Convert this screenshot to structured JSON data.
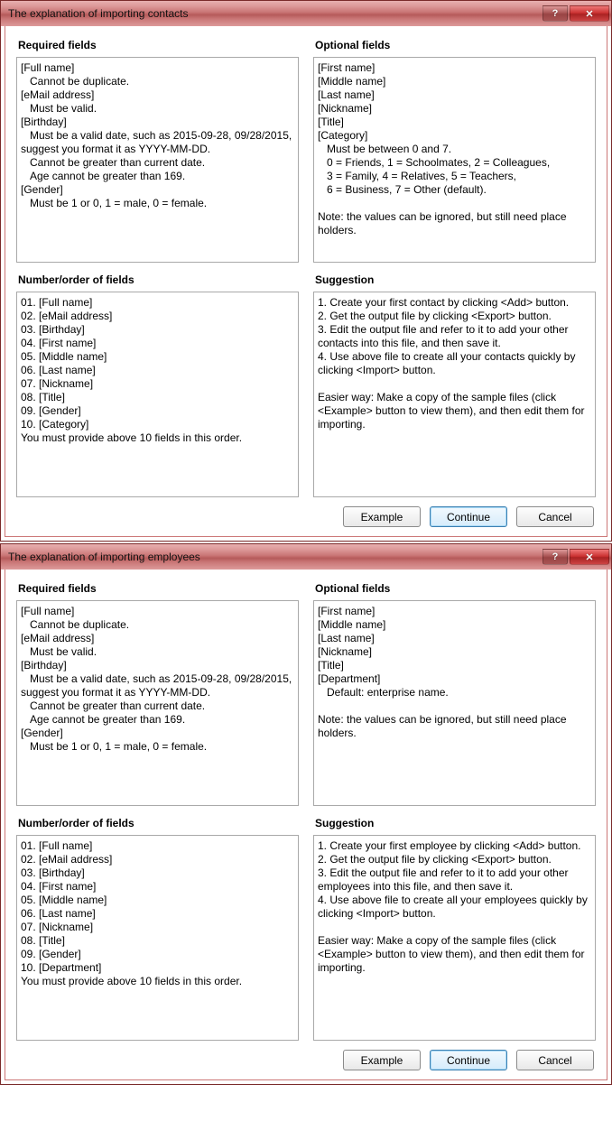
{
  "dialogs": [
    {
      "title": "The explanation of importing contacts",
      "required_label": "Required fields",
      "optional_label": "Optional fields",
      "order_label": "Number/order of fields",
      "suggestion_label": "Suggestion",
      "required_text": "[Full name]\n   Cannot be duplicate.\n[eMail address]\n   Must be valid.\n[Birthday]\n   Must be a valid date, such as 2015-09-28, 09/28/2015,\nsuggest you format it as YYYY-MM-DD.\n   Cannot be greater than current date.\n   Age cannot be greater than 169.\n[Gender]\n   Must be 1 or 0, 1 = male, 0 = female.",
      "optional_text": "[First name]\n[Middle name]\n[Last name]\n[Nickname]\n[Title]\n[Category]\n   Must be between 0 and 7.\n   0 = Friends, 1 = Schoolmates, 2 = Colleagues,\n   3 = Family, 4 = Relatives, 5 = Teachers,\n   6 = Business, 7 = Other (default).\n\nNote: the values can be ignored, but still need place\nholders.",
      "order_text": "01. [Full name]\n02. [eMail address]\n03. [Birthday]\n04. [First name]\n05. [Middle name]\n06. [Last name]\n07. [Nickname]\n08. [Title]\n09. [Gender]\n10. [Category]\nYou must provide above 10 fields in this order.",
      "suggestion_text": "1. Create your first contact by clicking <Add> button.\n2. Get the output file by clicking <Export> button.\n3. Edit the output file and refer to it to add your other\ncontacts into this file, and then save it.\n4. Use above file to create all your contacts quickly by\nclicking <Import> button.\n\nEasier way: Make a copy of the sample files (click\n<Example> button to view them), and then edit them for\nimporting.",
      "buttons": {
        "example": "Example",
        "continue": "Continue",
        "cancel": "Cancel"
      }
    },
    {
      "title": "The explanation of importing employees",
      "required_label": "Required fields",
      "optional_label": "Optional fields",
      "order_label": "Number/order of fields",
      "suggestion_label": "Suggestion",
      "required_text": "[Full name]\n   Cannot be duplicate.\n[eMail address]\n   Must be valid.\n[Birthday]\n   Must be a valid date, such as 2015-09-28, 09/28/2015,\nsuggest you format it as YYYY-MM-DD.\n   Cannot be greater than current date.\n   Age cannot be greater than 169.\n[Gender]\n   Must be 1 or 0, 1 = male, 0 = female.",
      "optional_text": "[First name]\n[Middle name]\n[Last name]\n[Nickname]\n[Title]\n[Department]\n   Default: enterprise name.\n\nNote: the values can be ignored, but still need place\nholders.",
      "order_text": "01. [Full name]\n02. [eMail address]\n03. [Birthday]\n04. [First name]\n05. [Middle name]\n06. [Last name]\n07. [Nickname]\n08. [Title]\n09. [Gender]\n10. [Department]\nYou must provide above 10 fields in this order.",
      "suggestion_text": "1. Create your first employee by clicking <Add> button.\n2. Get the output file by clicking <Export> button.\n3. Edit the output file and refer to it to add your other\nemployees into this file, and then save it.\n4. Use above file to create all your employees quickly by\nclicking <Import> button.\n\nEasier way: Make a copy of the sample files (click\n<Example> button to view them), and then edit them for\nimporting.",
      "buttons": {
        "example": "Example",
        "continue": "Continue",
        "cancel": "Cancel"
      }
    }
  ]
}
